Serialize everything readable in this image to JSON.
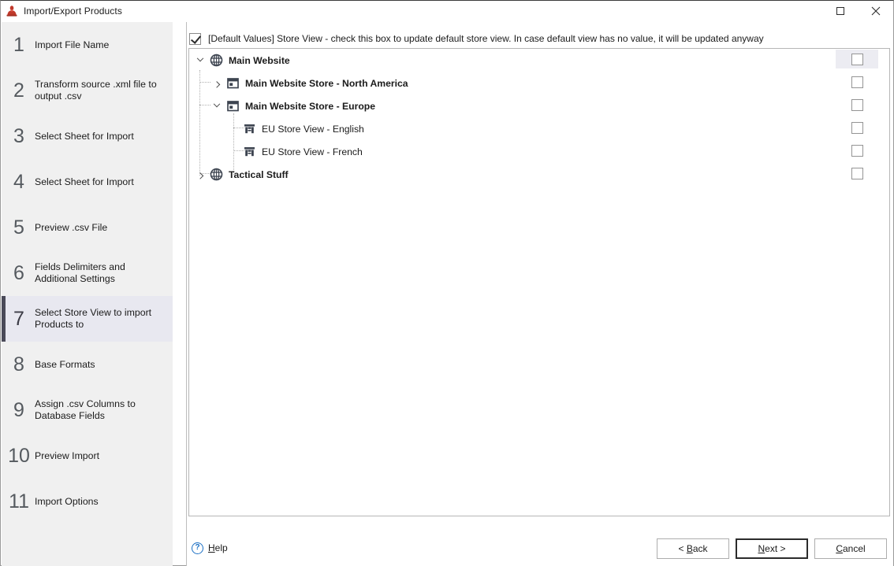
{
  "window": {
    "title": "Import/Export Products",
    "icon": "app-icon",
    "controls": [
      {
        "name": "maximize-button",
        "glyph": "maximize-icon"
      },
      {
        "name": "close-button",
        "glyph": "close-icon",
        "label": "✕"
      }
    ]
  },
  "sidebar": {
    "steps": [
      {
        "num": "1",
        "label": "Import File Name",
        "active": false
      },
      {
        "num": "2",
        "label": "Transform source .xml file to output .csv",
        "active": false
      },
      {
        "num": "3",
        "label": "Select Sheet for Import",
        "active": false
      },
      {
        "num": "4",
        "label": "Select Sheet for Import",
        "active": false
      },
      {
        "num": "5",
        "label": "Preview .csv File",
        "active": false
      },
      {
        "num": "6",
        "label": "Fields Delimiters and Additional Settings",
        "active": false
      },
      {
        "num": "7",
        "label": "Select Store View to import Products to",
        "active": true
      },
      {
        "num": "8",
        "label": "Base Formats",
        "active": false
      },
      {
        "num": "9",
        "label": "Assign .csv Columns to Database Fields",
        "active": false
      },
      {
        "num": "10",
        "label": "Preview Import",
        "active": false
      },
      {
        "num": "11",
        "label": "Import Options",
        "active": false
      }
    ]
  },
  "main": {
    "default_values": {
      "checked": true,
      "label": "[Default Values] Store View - check this box to update default store view. In case default view has no value, it will be updated anyway"
    },
    "tree": [
      {
        "label": "Main Website",
        "icon": "globe-icon",
        "level": 0,
        "twisty": "open",
        "bold": true,
        "checked": false,
        "selected": true
      },
      {
        "label": "Main Website Store - North America",
        "icon": "store-icon",
        "level": 1,
        "twisty": "closed",
        "bold": true,
        "checked": false,
        "selected": false
      },
      {
        "label": "Main Website Store - Europe",
        "icon": "store-icon",
        "level": 1,
        "twisty": "open",
        "bold": true,
        "checked": false,
        "selected": false
      },
      {
        "label": "EU Store View - English",
        "icon": "store-view-icon",
        "level": 2,
        "twisty": "none",
        "bold": false,
        "checked": false,
        "selected": false
      },
      {
        "label": "EU Store View - French",
        "icon": "store-view-icon",
        "level": 2,
        "twisty": "none",
        "bold": false,
        "checked": false,
        "selected": false
      },
      {
        "label": "Tactical Stuff",
        "icon": "globe-icon",
        "level": 0,
        "twisty": "closed",
        "bold": true,
        "checked": false,
        "selected": false
      }
    ]
  },
  "footer": {
    "help": {
      "icon": "question-mark-icon",
      "label_pre": "",
      "label_accel": "H",
      "label_post": "elp"
    },
    "buttons": [
      {
        "name": "back-button",
        "label": "< Back",
        "accel": "B",
        "default": false
      },
      {
        "name": "next-button",
        "label": "Next >",
        "accel": "N",
        "default": true
      },
      {
        "name": "cancel-button",
        "label": "Cancel",
        "accel": "C",
        "default": false
      }
    ]
  },
  "colors": {
    "accent_step": "#4a4a58",
    "active_step_bg": "#e8e8f0",
    "help_blue": "#1a6fc4",
    "sidebar_bg": "#f0f0f0"
  }
}
